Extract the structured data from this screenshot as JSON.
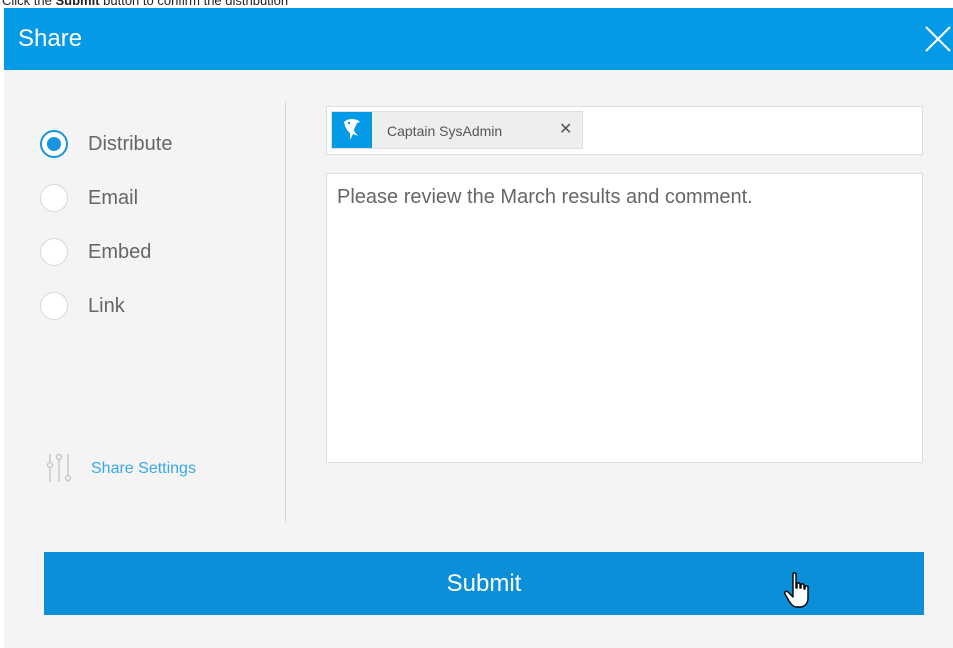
{
  "instruction": {
    "prefix": "Click the ",
    "bold": "Submit",
    "suffix": " button to confirm the distribution"
  },
  "dialog": {
    "title": "Share",
    "close_icon": "close-icon"
  },
  "share_options": [
    {
      "label": "Distribute",
      "selected": true
    },
    {
      "label": "Email",
      "selected": false
    },
    {
      "label": "Embed",
      "selected": false
    },
    {
      "label": "Link",
      "selected": false
    }
  ],
  "settings": {
    "label": "Share Settings",
    "icon": "sliders-icon"
  },
  "recipients": [
    {
      "name": "Captain SysAdmin",
      "avatar_icon": "shark-icon",
      "remove_icon": "remove-icon"
    }
  ],
  "message": {
    "value": "Please review the March results and comment."
  },
  "submit": {
    "label": "Submit"
  },
  "colors": {
    "header": "#049ae5",
    "submit": "#0a8fd8",
    "radio_selected": "#1a93e0",
    "link": "#3aa8e6",
    "background": "#f4f4f4"
  }
}
